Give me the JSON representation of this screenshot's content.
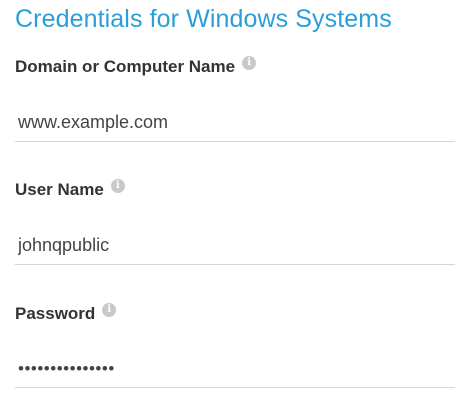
{
  "section": {
    "title": "Credentials for Windows Systems"
  },
  "fields": {
    "domain": {
      "label": "Domain or Computer Name",
      "value": "www.example.com",
      "info_icon": "info-icon"
    },
    "user": {
      "label": "User Name",
      "value": "johnqpublic",
      "info_icon": "info-icon"
    },
    "password": {
      "label": "Password",
      "value": "•••••••••••••••",
      "info_icon": "info-icon"
    }
  },
  "colors": {
    "title": "#2a9fd6",
    "label": "#333333",
    "input_text": "#444444",
    "underline": "#d6d6d6",
    "info_icon": "#c9c9c9"
  }
}
